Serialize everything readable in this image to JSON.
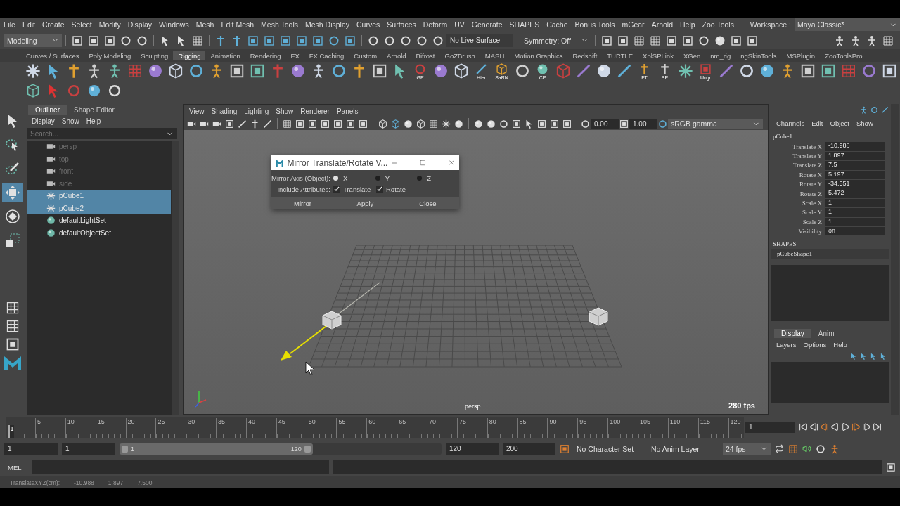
{
  "menu_bar": [
    "File",
    "Edit",
    "Create",
    "Select",
    "Modify",
    "Display",
    "Windows",
    "Mesh",
    "Edit Mesh",
    "Mesh Tools",
    "Mesh Display",
    "Curves",
    "Surfaces",
    "Deform",
    "UV",
    "Generate",
    "SHAPES",
    "Cache",
    "Bonus Tools",
    "mGear",
    "Arnold",
    "Help",
    "Zoo Tools"
  ],
  "workspace": {
    "label": "Workspace :",
    "value": "Maya Classic*"
  },
  "status_line": {
    "menu_set": "Modeling",
    "live_surface": "No Live Surface",
    "symmetry": "Symmetry: Off"
  },
  "shelf_tabs": [
    {
      "label": "Curves / Surfaces",
      "selected": false
    },
    {
      "label": "Poly Modeling",
      "selected": false
    },
    {
      "label": "Sculpting",
      "selected": false
    },
    {
      "label": "Rigging",
      "selected": true
    },
    {
      "label": "Animation",
      "selected": false
    },
    {
      "label": "Rendering",
      "selected": false
    },
    {
      "label": "FX",
      "selected": false
    },
    {
      "label": "FX Caching",
      "selected": false
    },
    {
      "label": "Custom",
      "selected": false
    },
    {
      "label": "Arnold",
      "selected": false
    },
    {
      "label": "Bifrost",
      "selected": false
    },
    {
      "label": "GoZBrush",
      "selected": false
    },
    {
      "label": "MASH",
      "selected": false
    },
    {
      "label": "Motion Graphics",
      "selected": false
    },
    {
      "label": "Redshift",
      "selected": false
    },
    {
      "label": "TURTLE",
      "selected": false
    },
    {
      "label": "XolSPLink",
      "selected": false
    },
    {
      "label": "XGen",
      "selected": false
    },
    {
      "label": "nm_rig",
      "selected": false
    },
    {
      "label": "ngSkinTools",
      "selected": false
    },
    {
      "label": "MSPlugin",
      "selected": false
    },
    {
      "label": "ZooToolsPro",
      "selected": false
    }
  ],
  "shelf_captions": [
    "GE",
    "Hier",
    "SaRN",
    "CP",
    "FT",
    "BP",
    "Ungr"
  ],
  "toolbox": [
    {
      "kind": "select",
      "selected": false
    },
    {
      "kind": "lasso",
      "selected": false
    },
    {
      "kind": "paint",
      "selected": false
    },
    {
      "kind": "move",
      "selected": true
    },
    {
      "kind": "rotate",
      "selected": false
    },
    {
      "kind": "scale",
      "selected": false
    }
  ],
  "outliner": {
    "tabs": [
      {
        "label": "Outliner",
        "selected": true
      },
      {
        "label": "Shape Editor",
        "selected": false
      }
    ],
    "menu": [
      "Display",
      "Show",
      "Help"
    ],
    "search": {
      "placeholder": "Search..."
    },
    "items": [
      {
        "label": "persp",
        "kind": "camera",
        "selected": false,
        "hidden": true
      },
      {
        "label": "top",
        "kind": "camera",
        "selected": false,
        "hidden": true
      },
      {
        "label": "front",
        "kind": "camera",
        "selected": false,
        "hidden": true
      },
      {
        "label": "side",
        "kind": "camera",
        "selected": false,
        "hidden": true
      },
      {
        "label": "pCube1",
        "kind": "transform",
        "selected": true,
        "hidden": false
      },
      {
        "label": "pCube2",
        "kind": "transform",
        "selected": true,
        "hidden": false
      },
      {
        "label": "defaultLightSet",
        "kind": "set",
        "selected": false,
        "hidden": false
      },
      {
        "label": "defaultObjectSet",
        "kind": "set",
        "selected": false,
        "hidden": false
      }
    ]
  },
  "viewport": {
    "menu": [
      "View",
      "Shading",
      "Lighting",
      "Show",
      "Renderer",
      "Panels"
    ],
    "exposure": "0.00",
    "gamma": "1.00",
    "color_space": "sRGB gamma",
    "camera": "persp",
    "fps": "280 fps"
  },
  "dialog": {
    "title": "Mirror Translate/Rotate V...",
    "axis_label": "Mirror Axis (Object):",
    "axes": [
      {
        "label": "X",
        "selected": true
      },
      {
        "label": "Y",
        "selected": false
      },
      {
        "label": "Z",
        "selected": false
      }
    ],
    "attributes_label": "Include Attributes:",
    "attributes": [
      {
        "label": "Translate",
        "checked": true
      },
      {
        "label": "Rotate",
        "checked": true
      }
    ],
    "buttons": [
      "Mirror",
      "Apply",
      "Close"
    ]
  },
  "channel_box": {
    "menu": [
      "Channels",
      "Edit",
      "Object",
      "Show"
    ],
    "object": "pCube1 . . .",
    "channels": [
      {
        "name": "Translate X",
        "value": "-10.988"
      },
      {
        "name": "Translate Y",
        "value": "1.897"
      },
      {
        "name": "Translate Z",
        "value": "7.5"
      },
      {
        "name": "Rotate X",
        "value": "5.197"
      },
      {
        "name": "Rotate Y",
        "value": "-34.551"
      },
      {
        "name": "Rotate Z",
        "value": "5.472"
      },
      {
        "name": "Scale X",
        "value": "1"
      },
      {
        "name": "Scale Y",
        "value": "1"
      },
      {
        "name": "Scale Z",
        "value": "1"
      },
      {
        "name": "Visibility",
        "value": "on"
      }
    ],
    "shapes_heading": "SHAPES",
    "shape": "pCubeShape1"
  },
  "layer_editor": {
    "tabs": [
      {
        "label": "Display",
        "selected": true
      },
      {
        "label": "Anim",
        "selected": false
      }
    ],
    "menu": [
      "Layers",
      "Options",
      "Help"
    ]
  },
  "time_slider": {
    "ticks": [
      "5",
      "10",
      "15",
      "20",
      "25",
      "30",
      "35",
      "40",
      "45",
      "50",
      "55",
      "60",
      "65",
      "70",
      "75",
      "80",
      "85",
      "90",
      "95",
      "100",
      "105",
      "110",
      "115",
      "120"
    ],
    "playhead": "1",
    "current_frame": "1"
  },
  "range_slider": {
    "level": 0.6,
    "start": "1",
    "playback_start": "1",
    "range_start": "1",
    "range_end": "120",
    "playback_end": "120",
    "end": "200",
    "character_set": "No Character Set",
    "anim_layer": "No Anim Layer",
    "frame_rate": "24 fps"
  },
  "command_line": {
    "language": "MEL"
  },
  "help_line": {
    "label": "TranslateXYZ(cm):",
    "values": [
      "-10.988",
      "1.897",
      "7.500"
    ]
  }
}
